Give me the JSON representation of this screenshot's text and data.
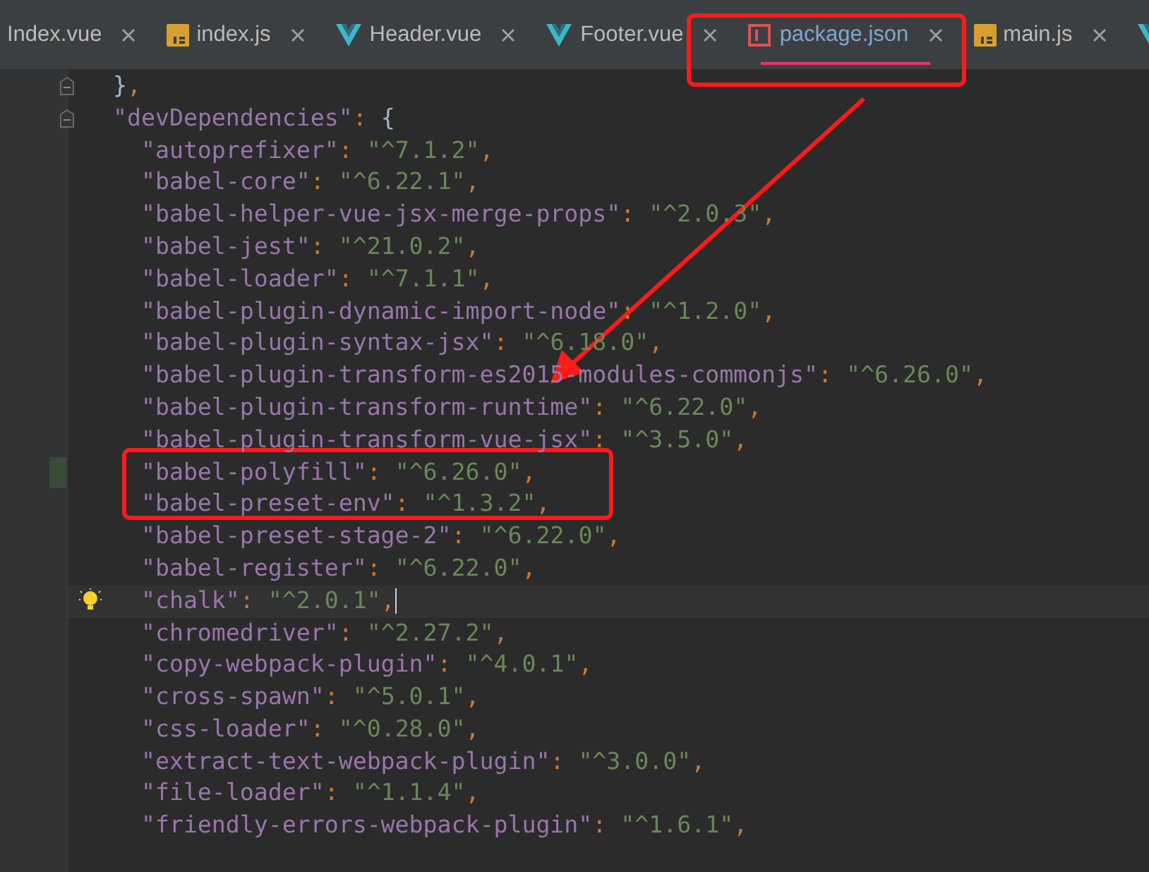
{
  "tabs": [
    {
      "label": "Index.vue",
      "kind": "plain",
      "selected": false
    },
    {
      "label": "index.js",
      "kind": "js",
      "selected": false
    },
    {
      "label": "Header.vue",
      "kind": "vue",
      "selected": false
    },
    {
      "label": "Footer.vue",
      "kind": "vue",
      "selected": false
    },
    {
      "label": "package.json",
      "kind": "json",
      "selected": true
    },
    {
      "label": "main.js",
      "kind": "js",
      "selected": false
    }
  ],
  "code_lines": [
    {
      "text": "},",
      "fold": true
    },
    {
      "text": "\"devDependencies\": {",
      "fold": true,
      "children": [
        {
          "text": "\"autoprefixer\": \"^7.1.2\",",
          "current": false,
          "changed": false
        },
        {
          "text": "\"babel-core\": \"^6.22.1\",",
          "current": false,
          "changed": false
        },
        {
          "text": "\"babel-helper-vue-jsx-merge-props\": \"^2.0.3\",",
          "current": false,
          "changed": false
        },
        {
          "text": "\"babel-jest\": \"^21.0.2\",",
          "current": false,
          "changed": false
        },
        {
          "text": "\"babel-loader\": \"^7.1.1\",",
          "current": false,
          "changed": false
        },
        {
          "text": "\"babel-plugin-dynamic-import-node\": \"^1.2.0\",",
          "current": false,
          "changed": false
        },
        {
          "text": "\"babel-plugin-syntax-jsx\": \"^6.18.0\",",
          "current": false,
          "changed": false
        },
        {
          "text": "\"babel-plugin-transform-es2015-modules-commonjs\": \"^6.26.0\",",
          "current": false,
          "changed": false
        },
        {
          "text": "\"babel-plugin-transform-runtime\": \"^6.22.0\",",
          "current": false,
          "changed": false
        },
        {
          "text": "\"babel-plugin-transform-vue-jsx\": \"^3.5.0\",",
          "current": false,
          "changed": false
        },
        {
          "text": "\"babel-polyfill\": \"^6.26.0\",",
          "current": false,
          "changed": true
        },
        {
          "text": "\"babel-preset-env\": \"^1.3.2\",",
          "current": false,
          "changed": false
        },
        {
          "text": "\"babel-preset-stage-2\": \"^6.22.0\",",
          "current": false,
          "changed": false
        },
        {
          "text": "\"babel-register\": \"^6.22.0\",",
          "current": false,
          "changed": false
        },
        {
          "text": "\"chalk\": \"^2.0.1\",",
          "current": true,
          "changed": false
        },
        {
          "text": "\"chromedriver\": \"^2.27.2\",",
          "current": false,
          "changed": false
        },
        {
          "text": "\"copy-webpack-plugin\": \"^4.0.1\",",
          "current": false,
          "changed": false
        },
        {
          "text": "\"cross-spawn\": \"^5.0.1\",",
          "current": false,
          "changed": false
        },
        {
          "text": "\"css-loader\": \"^0.28.0\",",
          "current": false,
          "changed": false
        },
        {
          "text": "\"extract-text-webpack-plugin\": \"^3.0.0\",",
          "current": false,
          "changed": false
        },
        {
          "text": "\"file-loader\": \"^1.1.4\",",
          "current": false,
          "changed": false
        },
        {
          "text": "\"friendly-errors-webpack-plugin\": \"^1.6.1\",",
          "current": false,
          "changed": false
        }
      ]
    }
  ]
}
